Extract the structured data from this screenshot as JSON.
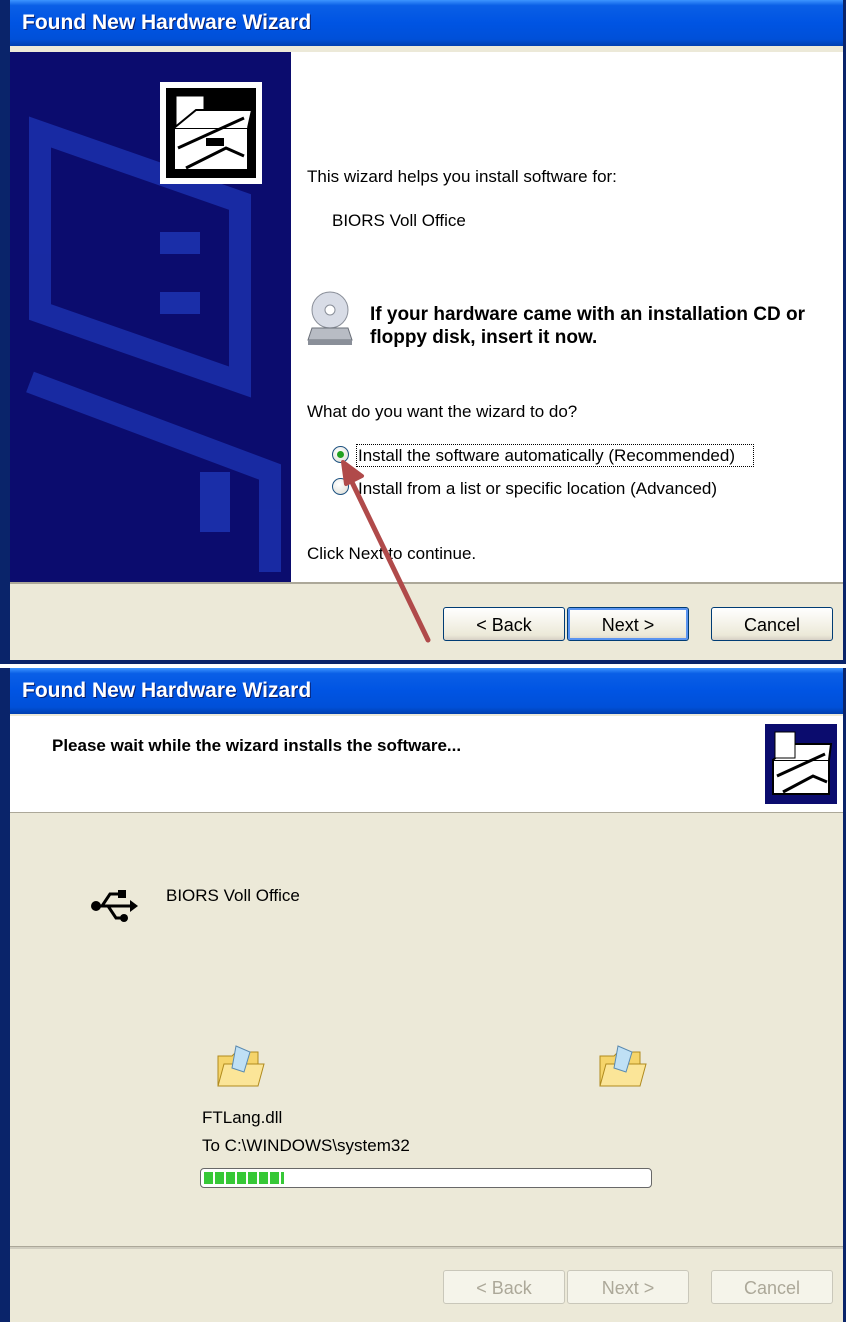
{
  "wizard1": {
    "title": "Found New Hardware Wizard",
    "intro": "This wizard helps you install software for:",
    "device": "BIORS Voll Office",
    "cd_notice": "If your hardware came with an installation CD or floppy disk, insert it now.",
    "question": "What do you want the wizard to do?",
    "options": [
      {
        "label": "Install the software automatically (Recommended)",
        "checked": true
      },
      {
        "label": "Install from a list or specific location (Advanced)",
        "checked": false
      }
    ],
    "continue_text": "Click Next to continue.",
    "buttons": {
      "back": "< Back",
      "next": "Next >",
      "cancel": "Cancel"
    }
  },
  "wizard2": {
    "title": "Found New Hardware Wizard",
    "heading": "Please wait while the wizard installs the software...",
    "device": "BIORS Voll Office",
    "file_name": "FTLang.dll",
    "destination": "To C:\\WINDOWS\\system32",
    "progress": 0.18,
    "buttons": {
      "back": "< Back",
      "next": "Next >",
      "cancel": "Cancel"
    }
  },
  "colors": {
    "titlebar": "#0054e3",
    "arrow": "#b04a4a",
    "progress": "#37c837"
  },
  "icons": [
    "hardware-wizard-icon",
    "cd-icon",
    "usb-icon",
    "folder-icon",
    "arrow-annotation"
  ]
}
